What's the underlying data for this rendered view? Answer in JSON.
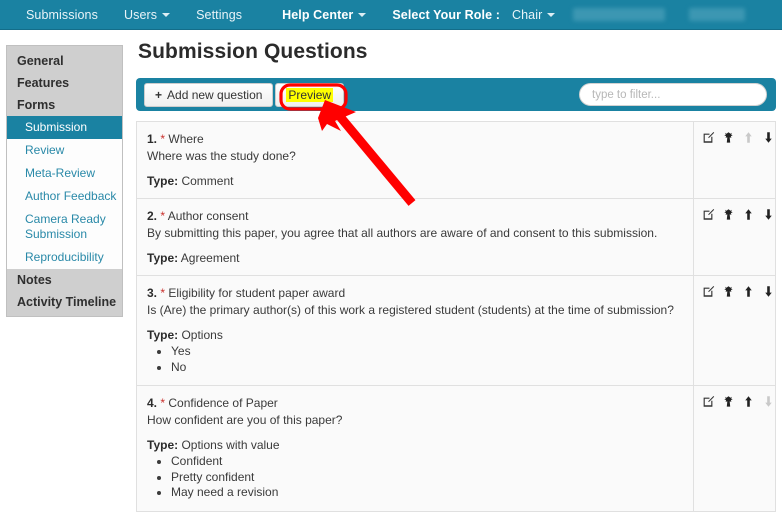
{
  "topbar": {
    "items": [
      {
        "label": "Submissions",
        "caret": false,
        "bold": false
      },
      {
        "label": "Users",
        "caret": true,
        "bold": false
      },
      {
        "label": "Settings",
        "caret": false,
        "bold": false
      },
      {
        "label": "Help Center",
        "caret": true,
        "bold": true
      },
      {
        "label": "Select Your Role :",
        "caret": false,
        "bold": true
      },
      {
        "label": "Chair",
        "caret": true,
        "bold": false
      }
    ],
    "accent_color": "#1a82a2"
  },
  "sidebar": {
    "groups": [
      {
        "label": "General"
      },
      {
        "label": "Features"
      },
      {
        "label": "Forms"
      }
    ],
    "forms_items": [
      {
        "label": "Submission",
        "active": true
      },
      {
        "label": "Review",
        "active": false
      },
      {
        "label": "Meta-Review",
        "active": false
      },
      {
        "label": "Author Feedback",
        "active": false
      },
      {
        "label": "Camera Ready Submission",
        "active": false
      },
      {
        "label": "Reproducibility",
        "active": false
      }
    ],
    "bottom_items": [
      {
        "label": "Notes"
      },
      {
        "label": "Activity Timeline"
      }
    ]
  },
  "main": {
    "page_title": "Submission Questions",
    "toolbar": {
      "add_label": "Add new question",
      "add_plus": "+",
      "preview_label": "Preview",
      "preview_highlight_color": "#ffff00"
    },
    "filter": {
      "placeholder": "type to filter...",
      "value": ""
    },
    "row_actions": [
      {
        "name": "edit-icon",
        "label": "Edit"
      },
      {
        "name": "delete-icon",
        "label": "Delete"
      },
      {
        "name": "move-up-icon",
        "label": "Move up"
      },
      {
        "name": "move-down-icon",
        "label": "Move down"
      }
    ],
    "questions": [
      {
        "number": "1.",
        "required": "*",
        "title": "Where",
        "text": "Where was the study done?",
        "type_label": "Type:",
        "type_value": "Comment",
        "options": [],
        "up_enabled": false,
        "down_enabled": true
      },
      {
        "number": "2.",
        "required": "*",
        "title": "Author consent",
        "text": "By submitting this paper, you agree that all authors are aware of and consent to this submission.",
        "type_label": "Type:",
        "type_value": "Agreement",
        "options": [],
        "up_enabled": true,
        "down_enabled": true
      },
      {
        "number": "3.",
        "required": "*",
        "title": "Eligibility for student paper award",
        "text": "Is (Are) the primary author(s) of this work a registered student (students) at the time of submission?",
        "type_label": "Type:",
        "type_value": "Options",
        "options": [
          "Yes",
          "No"
        ],
        "up_enabled": true,
        "down_enabled": true
      },
      {
        "number": "4.",
        "required": "*",
        "title": "Confidence of Paper",
        "text": "How confident are you of this paper?",
        "type_label": "Type:",
        "type_value": "Options with value",
        "options": [
          "Confident",
          "Pretty confident",
          "May need a revision"
        ],
        "up_enabled": true,
        "down_enabled": false
      }
    ]
  },
  "annotations": {
    "highlight_color": "#ff0000",
    "target": "Preview"
  }
}
